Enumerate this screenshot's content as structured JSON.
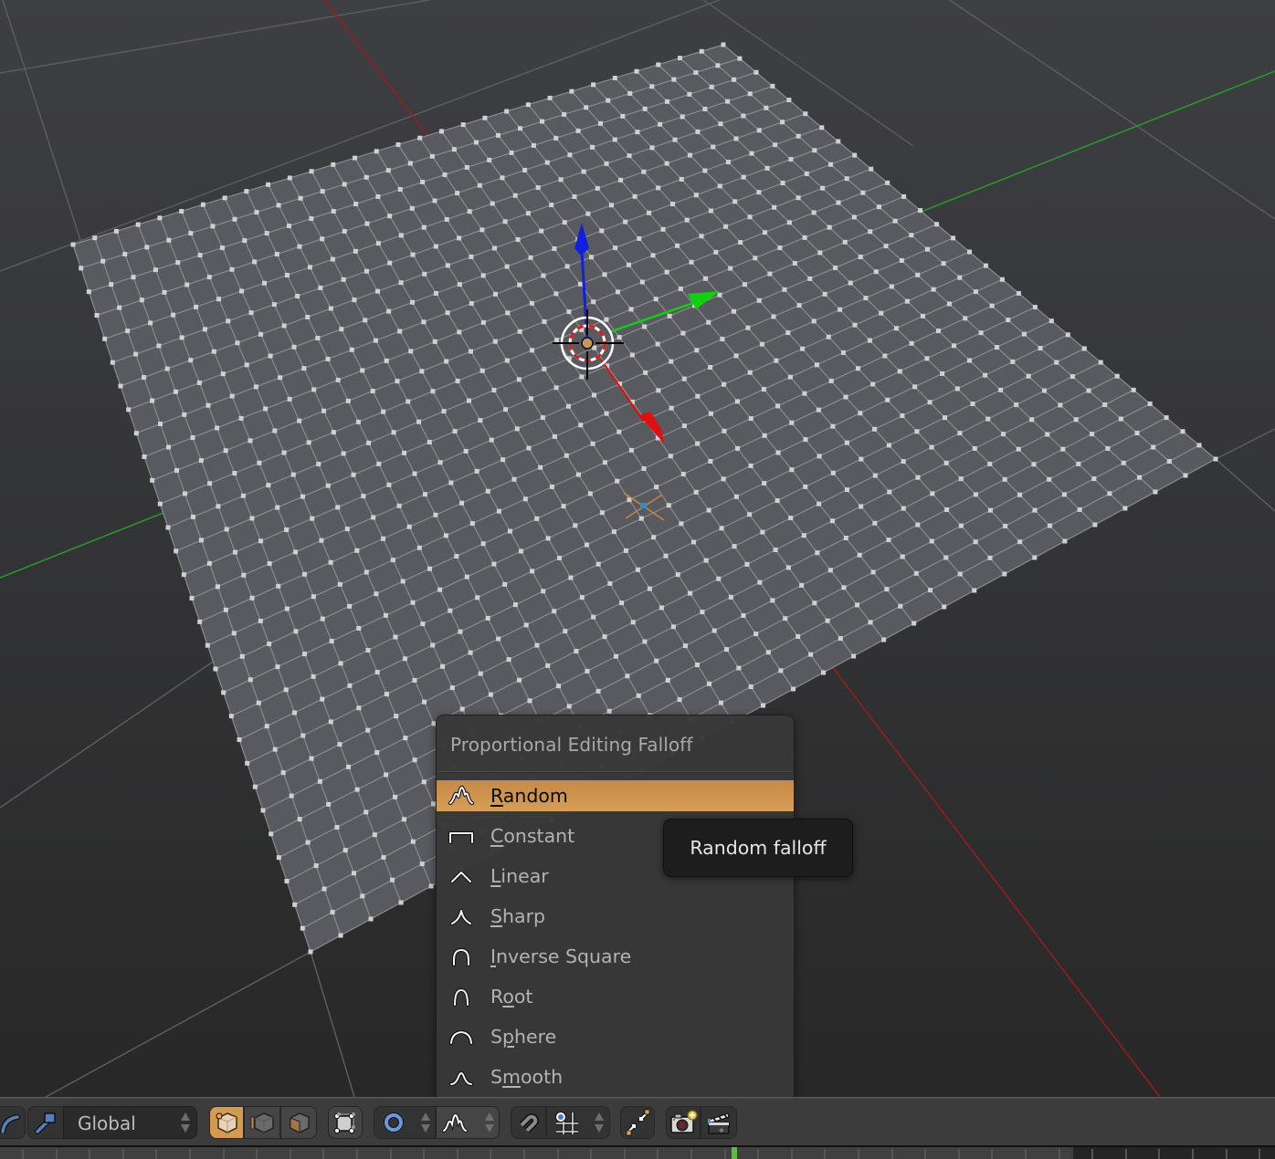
{
  "viewport": {
    "mode": "Edit Mode",
    "mesh": "Plane",
    "grid_subdivisions": 30,
    "selected_vertex_color": "#2a8fd6",
    "colors": {
      "background_top": "#3e3f43",
      "background_bottom": "#2a2a2a",
      "mesh_face": "#595a5f",
      "mesh_edge": "#8b8b8d",
      "vertex": "#d0d0d0",
      "axis_x": "#9c1c1c",
      "axis_y": "#2a9a2a",
      "grid_line": "#5b5c60",
      "gizmo_x": "#e01010",
      "gizmo_y": "#10d010",
      "gizmo_z": "#1020e0",
      "selected_edge": "#c8873a"
    }
  },
  "menu": {
    "title": "Proportional Editing Falloff",
    "items": [
      {
        "label": "Random",
        "underline": "R",
        "rest": "andom",
        "pre": "",
        "icon": "random-falloff-icon",
        "active": true
      },
      {
        "label": "Constant",
        "pre": "",
        "underline": "C",
        "rest": "onstant",
        "icon": "constant-falloff-icon",
        "active": false
      },
      {
        "label": "Linear",
        "pre": "",
        "underline": "L",
        "rest": "inear",
        "icon": "linear-falloff-icon",
        "active": false
      },
      {
        "label": "Sharp",
        "pre": "",
        "underline": "S",
        "rest": "harp",
        "icon": "sharp-falloff-icon",
        "active": false
      },
      {
        "label": "Inverse Square",
        "pre": "",
        "underline": "I",
        "rest": "nverse Square",
        "icon": "inverse-square-falloff-icon",
        "active": false
      },
      {
        "label": "Root",
        "pre": "R",
        "underline": "o",
        "rest": "ot",
        "icon": "root-falloff-icon",
        "active": false
      },
      {
        "label": "Sphere",
        "pre": "S",
        "underline": "p",
        "rest": "here",
        "icon": "sphere-falloff-icon",
        "active": false
      },
      {
        "label": "Smooth",
        "pre": "S",
        "underline": "m",
        "rest": "ooth",
        "icon": "smooth-falloff-icon",
        "active": false
      }
    ],
    "active_color": "#d0984f"
  },
  "tooltip": {
    "text": "Random falloff"
  },
  "header": {
    "orientation_value": "Global",
    "buttons": {
      "pivot_icon": "curve-handle-icon",
      "manipulator": "manipulator-icon",
      "vertex_select": "vertex-select-icon",
      "edge_select": "edge-select-icon",
      "face_select": "face-select-icon",
      "limit_selection": "limit-selection-icon",
      "proportional_edit": "proportional-edit-icon",
      "falloff": "random-falloff-icon",
      "snap": "magnet-icon",
      "snap_element": "snap-increment-icon",
      "mirror": "mirror-icon",
      "render": "camera-icon",
      "render_anim": "clapperboard-icon"
    },
    "accent_color": "#d39b50"
  },
  "timeline": {
    "current_frame_marker_color": "#59c03a"
  }
}
